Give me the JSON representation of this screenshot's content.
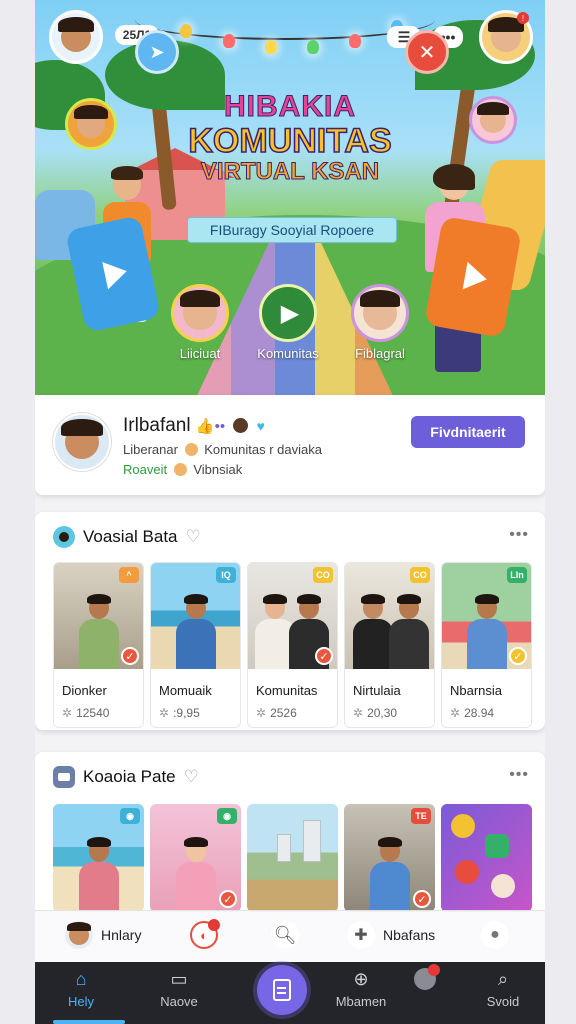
{
  "header": {
    "counter": "25Л1",
    "hero_title_1": "HIBAKIA",
    "hero_title_2": "KOMUNITAS",
    "hero_title_3": "VIRTUAL KSAN",
    "hero_ribbon": "FIBuragy Sooyial Ropoere",
    "categories": [
      {
        "label": "Liiciuat"
      },
      {
        "label": "Komunitas"
      },
      {
        "label": "Fiblagral"
      }
    ]
  },
  "profile": {
    "name": "Irlbafanl",
    "line1_a": "Liberanar",
    "line1_b": "Komunitas r daviaka",
    "line2_a": "Roaveit",
    "line2_b": "Vibnsiak",
    "follow_label": "Fivdnitaerit"
  },
  "section1": {
    "title": "Voasial Bata",
    "items": [
      {
        "title": "Dionker",
        "count": "12540",
        "badge_color": "#f39c3d"
      },
      {
        "title": "Momuaik",
        "count": ":9,95",
        "badge_color": "#3fb0d8"
      },
      {
        "title": "Komunitas",
        "count": "2526",
        "badge_color": "#f2c230"
      },
      {
        "title": "Nirtulaia",
        "count": "20,30",
        "badge_color": "#f2c230"
      },
      {
        "title": "Nbarnsia",
        "count": "28.94",
        "badge_color": "#35b06a"
      }
    ]
  },
  "section2": {
    "title": "Koaoia Pate"
  },
  "subbar": {
    "item1": "Hnlary",
    "item2": "Nbafans"
  },
  "nav": {
    "items": [
      {
        "label": "Hely"
      },
      {
        "label": "Naove"
      },
      {
        "label": "Mbamen"
      },
      {
        "label": "Svoid"
      }
    ]
  },
  "colors": {
    "accent": "#6d5fd9",
    "nav_bg": "#23252b",
    "active": "#4db3f5"
  }
}
